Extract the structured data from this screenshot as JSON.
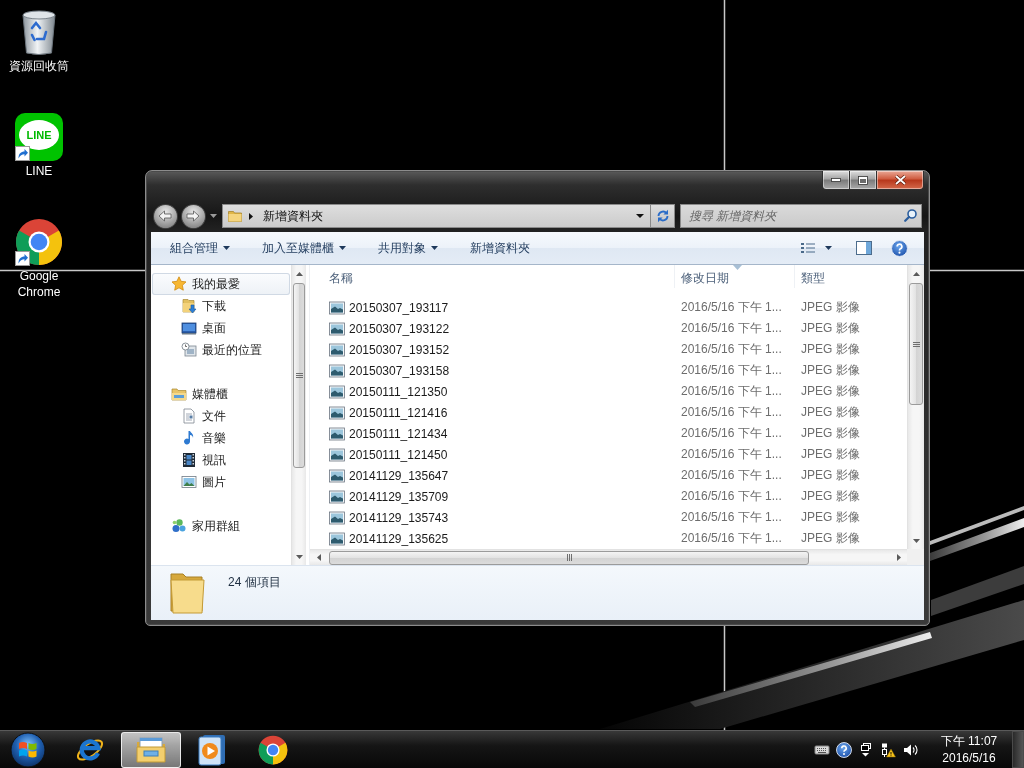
{
  "desktop": {
    "icons": [
      {
        "label": "資源回收筒",
        "kind": "bin",
        "shortcut": false
      },
      {
        "label": "LINE",
        "kind": "chat",
        "logo_text": "LINE",
        "shortcut": true
      },
      {
        "label": "Google Chrome",
        "kind": "browser",
        "shortcut": true
      }
    ]
  },
  "explorer": {
    "address": {
      "path": [
        "新增資料夾"
      ]
    },
    "search": {
      "placeholder": "搜尋 新增資料夾"
    },
    "toolbar": [
      {
        "label": "組合管理",
        "dropdown": true
      },
      {
        "label": "加入至媒體櫃",
        "dropdown": true
      },
      {
        "label": "共用對象",
        "dropdown": true
      },
      {
        "label": "新增資料夾",
        "dropdown": false
      }
    ],
    "sidebar": {
      "items": [
        {
          "label": "我的最愛",
          "kind": "favorites",
          "selected": true,
          "children": [
            {
              "label": "下載",
              "kind": "downloads",
              "selected": false
            },
            {
              "label": "桌面",
              "kind": "desktop",
              "selected": false
            },
            {
              "label": "最近的位置",
              "kind": "recent",
              "selected": false
            }
          ]
        },
        {
          "label": "媒體櫃",
          "kind": "libraries",
          "selected": false,
          "children": [
            {
              "label": "文件",
              "kind": "documents",
              "selected": false
            },
            {
              "label": "音樂",
              "kind": "music",
              "selected": false
            },
            {
              "label": "視訊",
              "kind": "videos",
              "selected": false
            },
            {
              "label": "圖片",
              "kind": "pictures",
              "selected": false
            }
          ]
        },
        {
          "label": "家用群組",
          "kind": "homegroup",
          "selected": false
        }
      ]
    },
    "table": {
      "columns": [
        {
          "label": "名稱",
          "sorted": false
        },
        {
          "label": "修改日期",
          "sorted": true
        },
        {
          "label": "類型",
          "sorted": false
        }
      ],
      "rows": [
        {
          "name": "20150307_193117",
          "modified": "2016/5/16 下午 1...",
          "file_type": "JPEG 影像",
          "selected": false
        },
        {
          "name": "20150307_193122",
          "modified": "2016/5/16 下午 1...",
          "file_type": "JPEG 影像",
          "selected": false
        },
        {
          "name": "20150307_193152",
          "modified": "2016/5/16 下午 1...",
          "file_type": "JPEG 影像",
          "selected": false
        },
        {
          "name": "20150307_193158",
          "modified": "2016/5/16 下午 1...",
          "file_type": "JPEG 影像",
          "selected": false
        },
        {
          "name": "20150111_121350",
          "modified": "2016/5/16 下午 1...",
          "file_type": "JPEG 影像",
          "selected": false
        },
        {
          "name": "20150111_121416",
          "modified": "2016/5/16 下午 1...",
          "file_type": "JPEG 影像",
          "selected": false
        },
        {
          "name": "20150111_121434",
          "modified": "2016/5/16 下午 1...",
          "file_type": "JPEG 影像",
          "selected": false
        },
        {
          "name": "20150111_121450",
          "modified": "2016/5/16 下午 1...",
          "file_type": "JPEG 影像",
          "selected": false
        },
        {
          "name": "20141129_135647",
          "modified": "2016/5/16 下午 1...",
          "file_type": "JPEG 影像",
          "selected": false
        },
        {
          "name": "20141129_135709",
          "modified": "2016/5/16 下午 1...",
          "file_type": "JPEG 影像",
          "selected": false
        },
        {
          "name": "20141129_135743",
          "modified": "2016/5/16 下午 1...",
          "file_type": "JPEG 影像",
          "selected": false
        },
        {
          "name": "20141129_135625",
          "modified": "2016/5/16 下午 1...",
          "file_type": "JPEG 影像",
          "selected": false
        }
      ]
    },
    "status_bar": {
      "text": "24 個項目"
    }
  },
  "taskbar": {
    "apps": [
      {
        "kind": "web",
        "active": false
      },
      {
        "kind": "files",
        "active": true
      },
      {
        "kind": "media",
        "active": false
      },
      {
        "kind": "browser",
        "active": false
      }
    ],
    "clock": {
      "time": "下午 11:07",
      "date": "2016/5/16"
    }
  }
}
